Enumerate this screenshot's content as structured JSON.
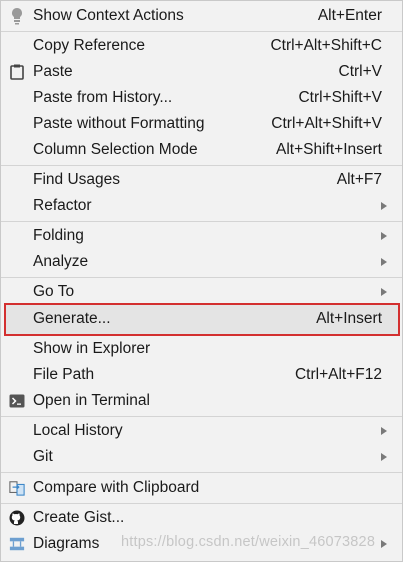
{
  "menu": {
    "items": [
      {
        "label": "Show Context Actions",
        "shortcut": "Alt+Enter"
      },
      {
        "label": "Copy Reference",
        "shortcut": "Ctrl+Alt+Shift+C"
      },
      {
        "label": "Paste",
        "shortcut": "Ctrl+V"
      },
      {
        "label": "Paste from History...",
        "shortcut": "Ctrl+Shift+V"
      },
      {
        "label": "Paste without Formatting",
        "shortcut": "Ctrl+Alt+Shift+V"
      },
      {
        "label": "Column Selection Mode",
        "shortcut": "Alt+Shift+Insert"
      },
      {
        "label": "Find Usages",
        "shortcut": "Alt+F7"
      },
      {
        "label": "Refactor",
        "shortcut": ""
      },
      {
        "label": "Folding",
        "shortcut": ""
      },
      {
        "label": "Analyze",
        "shortcut": ""
      },
      {
        "label": "Go To",
        "shortcut": ""
      },
      {
        "label": "Generate...",
        "shortcut": "Alt+Insert"
      },
      {
        "label": "Show in Explorer",
        "shortcut": ""
      },
      {
        "label": "File Path",
        "shortcut": "Ctrl+Alt+F12"
      },
      {
        "label": "Open in Terminal",
        "shortcut": ""
      },
      {
        "label": "Local History",
        "shortcut": ""
      },
      {
        "label": "Git",
        "shortcut": ""
      },
      {
        "label": "Compare with Clipboard",
        "shortcut": ""
      },
      {
        "label": "Create Gist...",
        "shortcut": ""
      },
      {
        "label": "Diagrams",
        "shortcut": ""
      }
    ]
  },
  "watermark": "https://blog.csdn.net/weixin_46073828",
  "colors": {
    "highlight_border": "#d32f2f",
    "background": "#f2f2f2"
  }
}
